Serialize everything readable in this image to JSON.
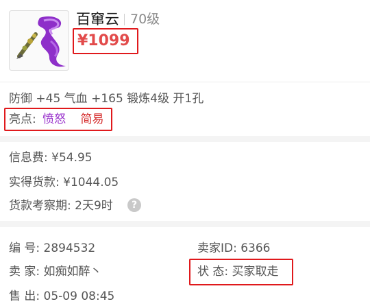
{
  "item": {
    "name": "百窜云",
    "level": "70级",
    "price": "¥1099",
    "image_icon": "purple-ribbon-weapon-icon"
  },
  "attributes": {
    "stats": "防御 +45 气血 +165 锻炼4级 开1孔",
    "highlight_label": "亮点:",
    "highlight_tags": [
      "愤怒",
      "简易"
    ]
  },
  "fees": {
    "info_fee": "信息费: ¥54.95",
    "actual_payment": "实得货款: ¥1044.05",
    "review_period": "货款考察期: 2天9时",
    "help_icon": "?"
  },
  "details": {
    "serial": "编 号:  2894532",
    "seller_id": "卖家ID:  6366",
    "seller": "卖 家:  如痴如醉丶",
    "status": "状 态:  买家取走",
    "sold": "售 出:  05-09 08:45"
  },
  "colors": {
    "highlight_box": "#e0191c",
    "price": "#e24b4b",
    "tag_purple": "#9932cc",
    "tag_red": "#d42a2a"
  }
}
